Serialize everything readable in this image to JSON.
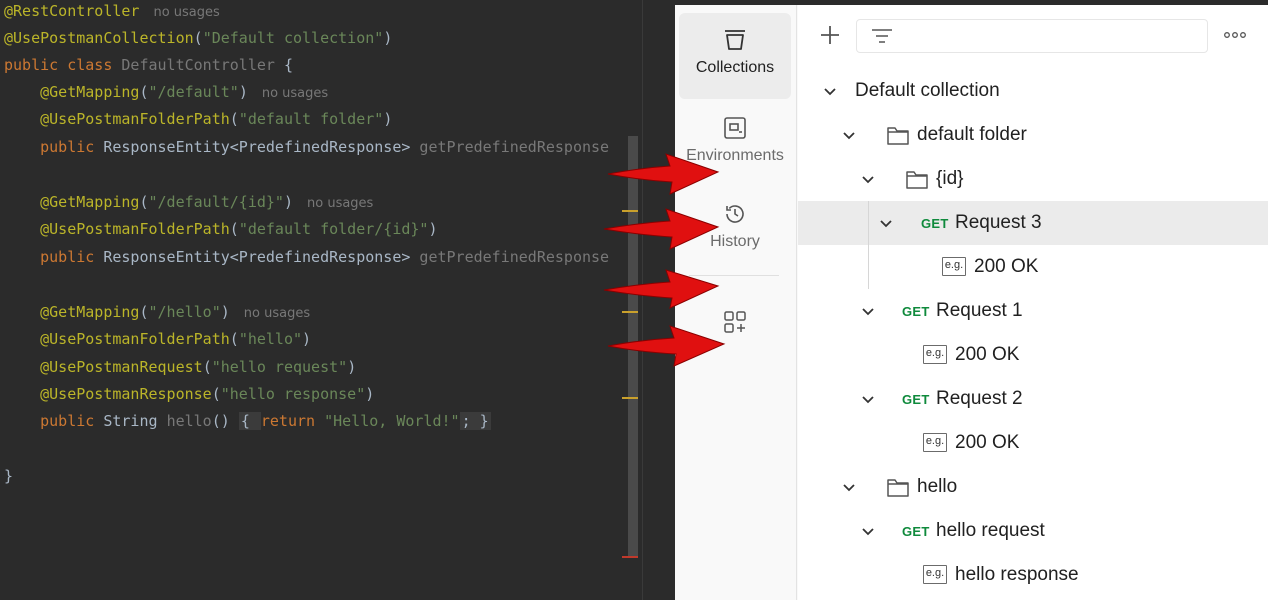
{
  "editor": {
    "lines": [
      {
        "segments": [
          {
            "t": "@RestController",
            "c": "ann"
          },
          {
            "t": "no usages",
            "c": "hint"
          }
        ]
      },
      {
        "segments": [
          {
            "t": "@UsePostmanCollection",
            "c": "ann"
          },
          {
            "t": "(",
            "c": "plain"
          },
          {
            "t": "\"Default collection\"",
            "c": "str"
          },
          {
            "t": ")",
            "c": "plain"
          }
        ]
      },
      {
        "segments": [
          {
            "t": "public class ",
            "c": "kw"
          },
          {
            "t": "DefaultController ",
            "c": "dim"
          },
          {
            "t": "{",
            "c": "plain"
          }
        ]
      },
      {
        "segments": [
          {
            "t": "    @GetMapping",
            "c": "ann"
          },
          {
            "t": "(",
            "c": "plain"
          },
          {
            "t": "\"/default\"",
            "c": "str"
          },
          {
            "t": ")",
            "c": "plain"
          },
          {
            "t": "no usages",
            "c": "hint"
          }
        ]
      },
      {
        "segments": [
          {
            "t": "    @UsePostmanFolderPath",
            "c": "ann"
          },
          {
            "t": "(",
            "c": "plain"
          },
          {
            "t": "\"default folder\"",
            "c": "str"
          },
          {
            "t": ")",
            "c": "plain"
          }
        ]
      },
      {
        "segments": [
          {
            "t": "    public ",
            "c": "kw"
          },
          {
            "t": "ResponseEntity<PredefinedResponse> ",
            "c": "plain"
          },
          {
            "t": "getPredefinedResponse",
            "c": "dim"
          }
        ]
      },
      {
        "segments": []
      },
      {
        "segments": [
          {
            "t": "    @GetMapping",
            "c": "ann"
          },
          {
            "t": "(",
            "c": "plain"
          },
          {
            "t": "\"/default/{id}\"",
            "c": "str"
          },
          {
            "t": ")",
            "c": "plain"
          },
          {
            "t": "no usages",
            "c": "hint"
          }
        ]
      },
      {
        "segments": [
          {
            "t": "    @UsePostmanFolderPath",
            "c": "ann"
          },
          {
            "t": "(",
            "c": "plain"
          },
          {
            "t": "\"default folder/{id}\"",
            "c": "str"
          },
          {
            "t": ")",
            "c": "plain"
          }
        ]
      },
      {
        "segments": [
          {
            "t": "    public ",
            "c": "kw"
          },
          {
            "t": "ResponseEntity<PredefinedResponse> ",
            "c": "plain"
          },
          {
            "t": "getPredefinedResponse",
            "c": "dim"
          }
        ]
      },
      {
        "segments": []
      },
      {
        "segments": [
          {
            "t": "    @GetMapping",
            "c": "ann"
          },
          {
            "t": "(",
            "c": "plain"
          },
          {
            "t": "\"/hello\"",
            "c": "str"
          },
          {
            "t": ")",
            "c": "plain"
          },
          {
            "t": "no usages",
            "c": "hint"
          }
        ]
      },
      {
        "segments": [
          {
            "t": "    @UsePostmanFolderPath",
            "c": "ann"
          },
          {
            "t": "(",
            "c": "plain"
          },
          {
            "t": "\"hello\"",
            "c": "str"
          },
          {
            "t": ")",
            "c": "plain"
          }
        ]
      },
      {
        "segments": [
          {
            "t": "    @UsePostmanRequest",
            "c": "ann"
          },
          {
            "t": "(",
            "c": "plain"
          },
          {
            "t": "\"hello request\"",
            "c": "str"
          },
          {
            "t": ")",
            "c": "plain"
          }
        ]
      },
      {
        "segments": [
          {
            "t": "    @UsePostmanResponse",
            "c": "ann"
          },
          {
            "t": "(",
            "c": "plain"
          },
          {
            "t": "\"hello response\"",
            "c": "str"
          },
          {
            "t": ")",
            "c": "plain"
          }
        ]
      },
      {
        "segments": [
          {
            "t": "    public ",
            "c": "kw"
          },
          {
            "t": "String ",
            "c": "plain"
          },
          {
            "t": "hello",
            "c": "dim"
          },
          {
            "t": "() ",
            "c": "plain"
          },
          {
            "t": "{ ",
            "c": "fold"
          },
          {
            "t": "return ",
            "c": "kw"
          },
          {
            "t": "\"Hello, World!\"",
            "c": "str"
          },
          {
            "t": "; }",
            "c": "fold"
          }
        ]
      },
      {
        "segments": []
      },
      {
        "segments": [
          {
            "t": "}",
            "c": "plain"
          }
        ]
      }
    ]
  },
  "postman": {
    "rail": {
      "collections": "Collections",
      "environments": "Environments",
      "history": "History"
    },
    "filter": {
      "value": ""
    },
    "tree": {
      "collection": "Default collection",
      "folder_default": "default folder",
      "folder_id": "{id}",
      "request3": "Request 3",
      "request3_resp": "200 OK",
      "request1": "Request 1",
      "request1_resp": "200 OK",
      "request2": "Request 2",
      "request2_resp": "200 OK",
      "folder_hello": "hello",
      "hello_request": "hello request",
      "hello_response": "hello response",
      "method": "GET",
      "example_badge": "e.g."
    }
  },
  "colors": {
    "arrow": "#e01010",
    "get": "#0f8a3c",
    "annotation": "#bbb529",
    "string": "#6a8759",
    "keyword": "#cc7832"
  }
}
